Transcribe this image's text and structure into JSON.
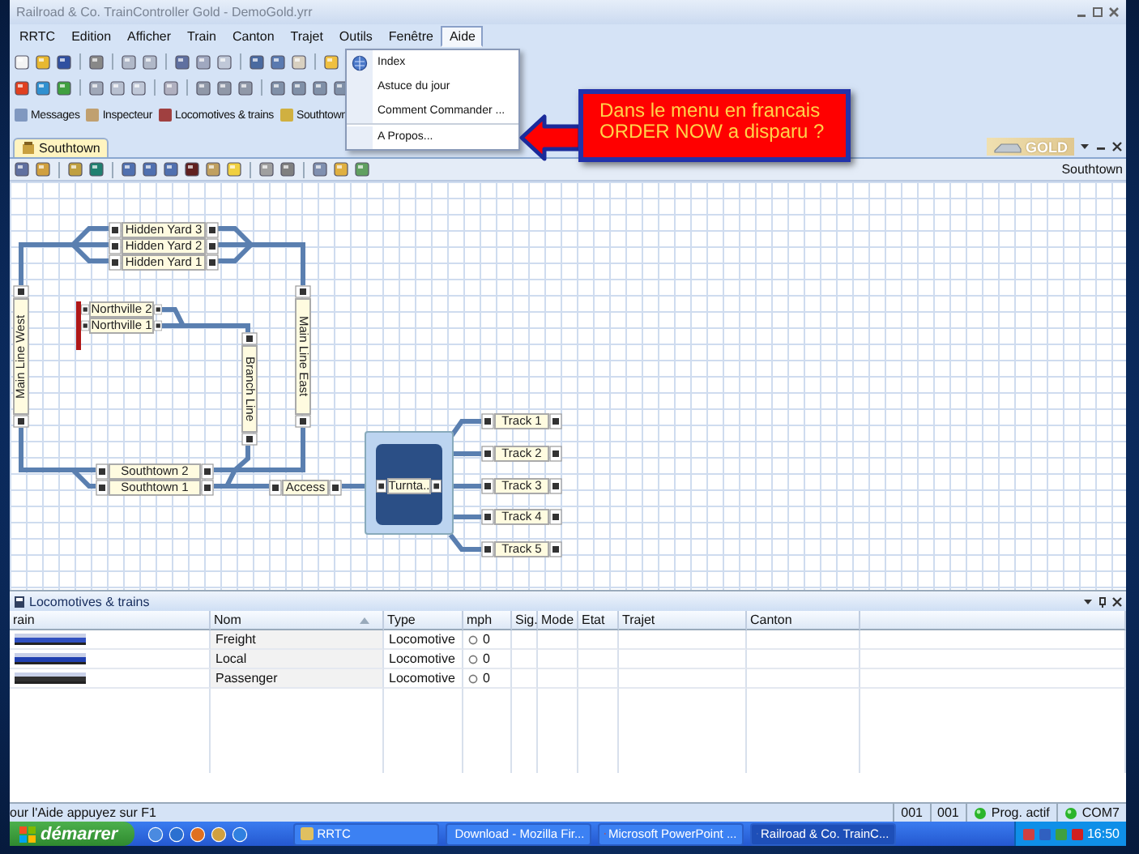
{
  "window": {
    "title": "Railroad & Co. TrainController Gold - DemoGold.yrr"
  },
  "menu_bar": [
    {
      "label": "RRTC",
      "open": false
    },
    {
      "label": "Edition",
      "open": false
    },
    {
      "label": "Afficher",
      "open": false
    },
    {
      "label": "Train",
      "open": false
    },
    {
      "label": "Canton",
      "open": false
    },
    {
      "label": "Trajet",
      "open": false
    },
    {
      "label": "Outils",
      "open": false
    },
    {
      "label": "Fenêtre",
      "open": false
    },
    {
      "label": "Aide",
      "open": true
    }
  ],
  "menu_dropdown": [
    {
      "label": "Index",
      "icon": true,
      "separator_before": false
    },
    {
      "label": "Astuce du jour",
      "icon": false,
      "separator_before": false
    },
    {
      "label": "Comment Commander ...",
      "icon": false,
      "separator_before": false
    },
    {
      "label": "A Propos...",
      "icon": false,
      "separator_before": true
    }
  ],
  "panel_buttons": [
    "Messages",
    "Inspecteur",
    "Locomotives & trains",
    "Southtown"
  ],
  "document_tabs": [
    {
      "label": "Southtown",
      "selected": true
    }
  ],
  "edition_badge": "GOLD",
  "view_title": "Southtown",
  "layout": {
    "blocks": [
      {
        "label": "Hidden Yard 3",
        "kind": "horizontal",
        "end_stop": false
      },
      {
        "label": "Hidden Yard 2",
        "kind": "horizontal",
        "end_stop": false
      },
      {
        "label": "Hidden Yard 1",
        "kind": "horizontal",
        "end_stop": false
      },
      {
        "label": "Northville 2",
        "kind": "horizontal",
        "end_stop": true
      },
      {
        "label": "Northville 1",
        "kind": "horizontal",
        "end_stop": true
      },
      {
        "label": "Main Line West",
        "kind": "vertical",
        "end_stop": false
      },
      {
        "label": "Main Line East",
        "kind": "vertical",
        "end_stop": false
      },
      {
        "label": "Branch Line",
        "kind": "vertical",
        "end_stop": false
      },
      {
        "label": "Southtown 2",
        "kind": "horizontal",
        "end_stop": false
      },
      {
        "label": "Southtown 1",
        "kind": "horizontal",
        "end_stop": false
      },
      {
        "label": "Access",
        "kind": "horizontal",
        "end_stop": false
      },
      {
        "label": "Track 1",
        "kind": "horizontal",
        "end_stop": false
      },
      {
        "label": "Track 2",
        "kind": "horizontal",
        "end_stop": false
      },
      {
        "label": "Track 3",
        "kind": "horizontal",
        "end_stop": false
      },
      {
        "label": "Track 4",
        "kind": "horizontal",
        "end_stop": false
      },
      {
        "label": "Track 5",
        "kind": "horizontal",
        "end_stop": false
      }
    ],
    "turntable": {
      "label": "Turnta.."
    }
  },
  "callout": {
    "lines": [
      "Dans le menu en francais",
      "ORDER NOW a disparu ?"
    ]
  },
  "locomotives_panel": {
    "title": "Locomotives & trains",
    "columns": [
      {
        "label": "rain",
        "sorted": false
      },
      {
        "label": "Nom",
        "sorted": true
      },
      {
        "label": "Type",
        "sorted": false
      },
      {
        "label": "mph",
        "sorted": false
      },
      {
        "label": "Sig.",
        "sorted": false
      },
      {
        "label": "Mode",
        "sorted": false
      },
      {
        "label": "Etat",
        "sorted": false
      },
      {
        "label": "Trajet",
        "sorted": false
      },
      {
        "label": "Canton",
        "sorted": false
      }
    ],
    "rows": [
      {
        "name": "Freight",
        "type": "Locomotive",
        "mph": "0"
      },
      {
        "name": "Local",
        "type": "Locomotive",
        "mph": "0"
      },
      {
        "name": "Passenger",
        "type": "Locomotive",
        "mph": "0"
      }
    ]
  },
  "status_bar": [
    {
      "text": "our l'Aide appuyez sur F1",
      "indicator": false
    },
    {
      "text": "001",
      "indicator": false
    },
    {
      "text": "001",
      "indicator": false
    },
    {
      "text": "Prog. actif",
      "indicator": true
    },
    {
      "text": "COM7",
      "indicator": true
    }
  ],
  "taskbar": {
    "start": "démarrer",
    "tasks": [
      {
        "label": "RRTC",
        "active": false
      },
      {
        "label": "Download - Mozilla Fir...",
        "active": false
      },
      {
        "label": "Microsoft PowerPoint ...",
        "active": false
      },
      {
        "label": "Railroad & Co. TrainC...",
        "active": true
      }
    ],
    "clock": "16:50"
  }
}
